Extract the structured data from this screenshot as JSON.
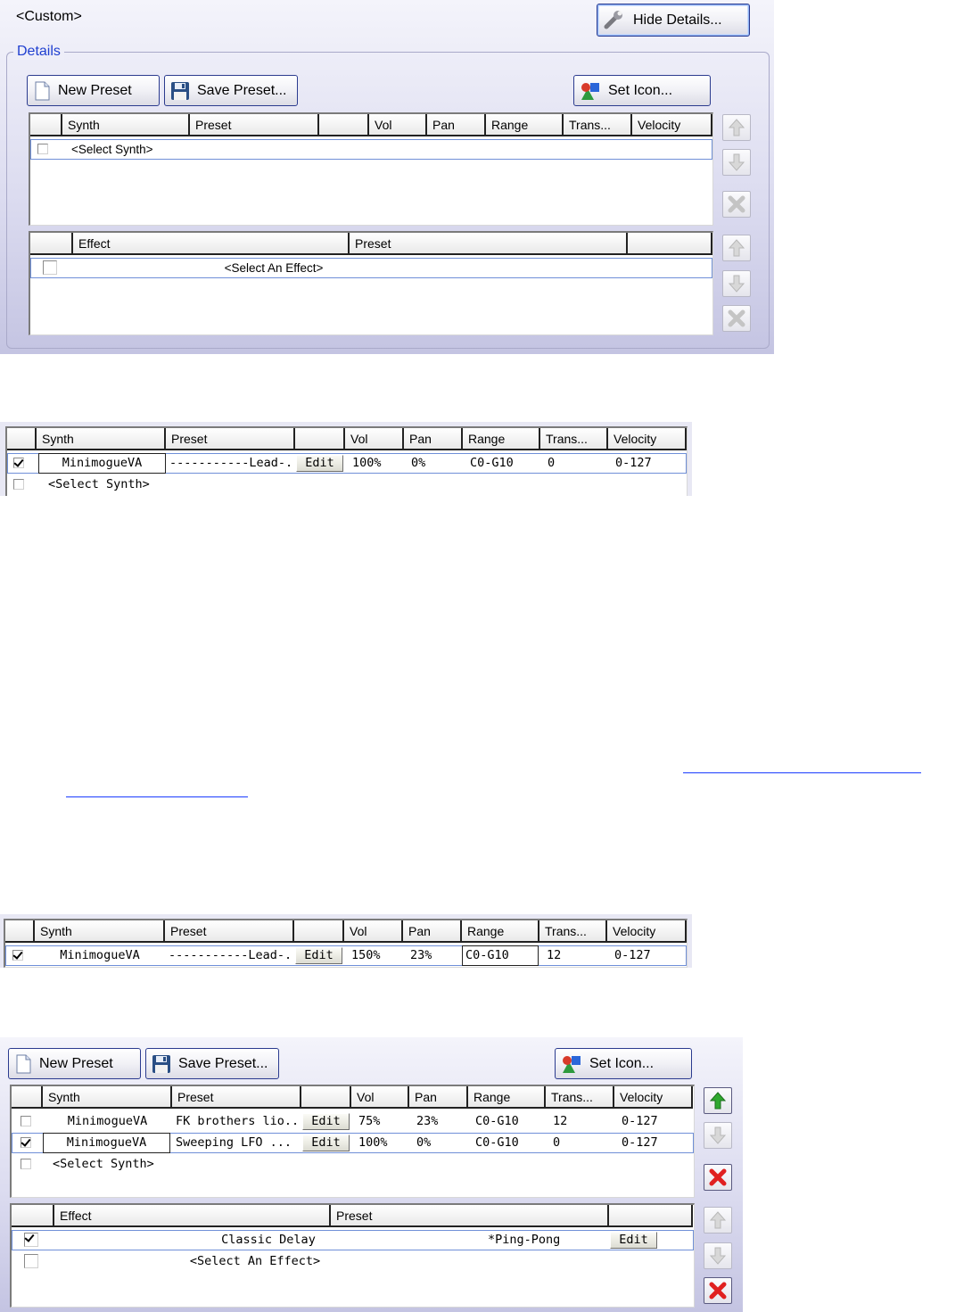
{
  "top_panel": {
    "preset_name": "<Custom>",
    "hide_details_label": "Hide Details...",
    "details_label": "Details",
    "toolbar": {
      "new_preset": "New Preset",
      "save_preset": "Save Preset...",
      "set_icon": "Set Icon..."
    },
    "synth_columns": [
      "Synth",
      "Preset",
      "",
      "Vol",
      "Pan",
      "Range",
      "Trans...",
      "Velocity"
    ],
    "synth_rows": [
      {
        "checked": false,
        "synth": "<Select Synth>"
      }
    ],
    "effect_columns": [
      "Effect",
      "Preset",
      ""
    ],
    "effect_rows": [
      {
        "checked": false,
        "effect": "<Select An Effect>"
      }
    ]
  },
  "example_one": {
    "synth_columns": [
      "Synth",
      "Preset",
      "",
      "Vol",
      "Pan",
      "Range",
      "Trans...",
      "Velocity"
    ],
    "rows": [
      {
        "checked": true,
        "synth": "MinimogueVA",
        "preset": "-----------Lead-...",
        "edit": "Edit",
        "vol": "100%",
        "pan": "0%",
        "range": "C0-G10",
        "trans": "0",
        "velocity": "0-127"
      },
      {
        "checked": false,
        "synth": "<Select Synth>"
      }
    ]
  },
  "example_two": {
    "synth_columns": [
      "Synth",
      "Preset",
      "",
      "Vol",
      "Pan",
      "Range",
      "Trans...",
      "Velocity"
    ],
    "rows": [
      {
        "checked": true,
        "synth": "MinimogueVA",
        "preset": "-----------Lead-...",
        "edit": "Edit",
        "vol": "150%",
        "pan": "23%",
        "range": "C0-G10",
        "trans": "12",
        "velocity": "0-127"
      }
    ]
  },
  "bottom_panel": {
    "toolbar": {
      "new_preset": "New Preset",
      "save_preset": "Save Preset...",
      "set_icon": "Set Icon..."
    },
    "synth_columns": [
      "Synth",
      "Preset",
      "",
      "Vol",
      "Pan",
      "Range",
      "Trans...",
      "Velocity"
    ],
    "synth_rows": [
      {
        "checked": false,
        "synth": "MinimogueVA",
        "preset": "FK brothers lio...",
        "edit": "Edit",
        "vol": "75%",
        "pan": "23%",
        "range": "C0-G10",
        "trans": "12",
        "velocity": "0-127"
      },
      {
        "checked": true,
        "synth": "MinimogueVA",
        "preset": "Sweeping LFO ...",
        "edit": "Edit",
        "vol": "100%",
        "pan": "0%",
        "range": "C0-G10",
        "trans": "0",
        "velocity": "0-127"
      },
      {
        "checked": false,
        "synth": "<Select Synth>"
      }
    ],
    "effect_columns": [
      "Effect",
      "Preset",
      ""
    ],
    "effect_rows": [
      {
        "checked": true,
        "effect": "Classic Delay",
        "preset": "*Ping-Pong",
        "edit": "Edit"
      },
      {
        "checked": false,
        "effect": "<Select An Effect>"
      }
    ]
  },
  "icons": {
    "wrench": "wrench-icon",
    "new_document": "new-document-icon",
    "floppy": "floppy-disk-icon",
    "shapes": "shapes-icon",
    "up": "arrow-up-icon",
    "down": "arrow-down-icon",
    "delete": "delete-x-icon"
  },
  "colors": {
    "details_label": "#1f3fd0",
    "active_up_arrow": "#2fa82f",
    "active_delete": "#e02020",
    "selection_outline": "#6f8fd8",
    "link": "#1a3cff"
  }
}
